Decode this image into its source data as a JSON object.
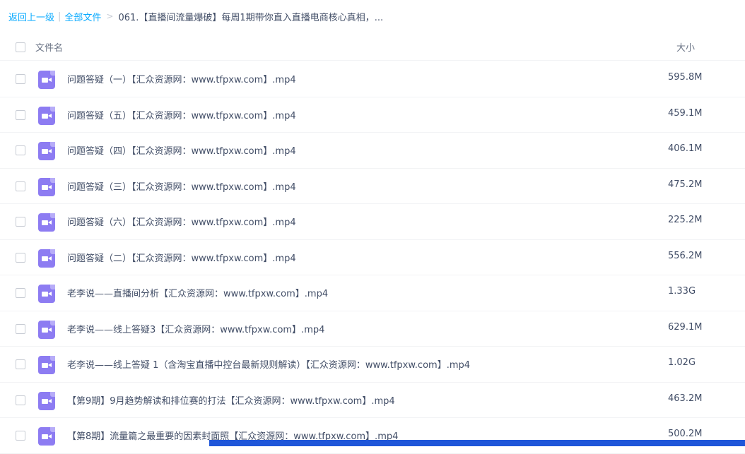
{
  "breadcrumb": {
    "back": "返回上一级",
    "sep": "|",
    "all_files": "全部文件",
    "arrow": ">",
    "current": "061.【直播间流量爆破】每周1期带你直入直播电商核心真相，..."
  },
  "table": {
    "header_name": "文件名",
    "header_size": "大小",
    "files": [
      {
        "name": "问题答疑（一）【汇众资源网：www.tfpxw.com】.mp4",
        "size": "595.8M",
        "icon": "video-file-icon"
      },
      {
        "name": "问题答疑（五）【汇众资源网：www.tfpxw.com】.mp4",
        "size": "459.1M",
        "icon": "video-file-icon"
      },
      {
        "name": "问题答疑（四）【汇众资源网：www.tfpxw.com】.mp4",
        "size": "406.1M",
        "icon": "video-file-icon"
      },
      {
        "name": "问题答疑（三）【汇众资源网：www.tfpxw.com】.mp4",
        "size": "475.2M",
        "icon": "video-file-icon"
      },
      {
        "name": "问题答疑（六）【汇众资源网：www.tfpxw.com】.mp4",
        "size": "225.2M",
        "icon": "video-file-icon"
      },
      {
        "name": "问题答疑（二）【汇众资源网：www.tfpxw.com】.mp4",
        "size": "556.2M",
        "icon": "video-file-icon"
      },
      {
        "name": "老李说——直播间分析【汇众资源网：www.tfpxw.com】.mp4",
        "size": "1.33G",
        "icon": "video-file-icon"
      },
      {
        "name": "老李说——线上答疑3【汇众资源网：www.tfpxw.com】.mp4",
        "size": "629.1M",
        "icon": "video-file-icon"
      },
      {
        "name": "老李说——线上答疑 1（含淘宝直播中控台最新规则解读）【汇众资源网：www.tfpxw.com】.mp4",
        "size": "1.02G",
        "icon": "video-file-icon"
      },
      {
        "name": "【第9期】9月趋势解读和排位赛的打法【汇众资源网：www.tfpxw.com】.mp4",
        "size": "463.2M",
        "icon": "video-file-icon"
      },
      {
        "name": "【第8期】流量篇之最重要的因素封面照【汇众资源网：www.tfpxw.com】.mp4",
        "size": "500.2M",
        "icon": "video-file-icon"
      }
    ]
  },
  "colors": {
    "link": "#09aaff",
    "text": "#424e67",
    "video_icon": "#8d7cf2",
    "bottom_bar": "#1f56d9"
  }
}
